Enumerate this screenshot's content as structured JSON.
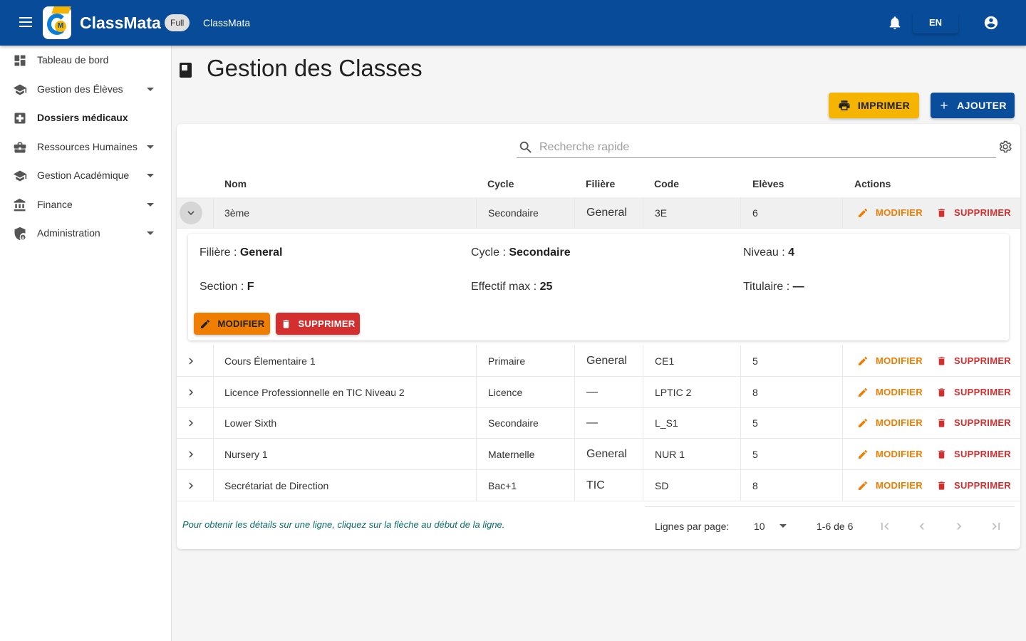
{
  "app": {
    "brand": "ClassMata",
    "plan_badge": "Full",
    "subtitle": "ClassMata",
    "language": "EN",
    "primary_color": "#084c99"
  },
  "sidebar": {
    "items": [
      {
        "label": "Tableau de bord",
        "icon": "dashboard-icon",
        "expandable": false,
        "active": false
      },
      {
        "label": "Gestion des Élèves",
        "icon": "school-icon",
        "expandable": true,
        "active": false
      },
      {
        "label": "Dossiers médicaux",
        "icon": "medical-icon",
        "expandable": false,
        "active": true
      },
      {
        "label": "Ressources Humaines",
        "icon": "briefcase-icon",
        "expandable": true,
        "active": false
      },
      {
        "label": "Gestion Académique",
        "icon": "school-icon",
        "expandable": true,
        "active": false
      },
      {
        "label": "Finance",
        "icon": "bank-icon",
        "expandable": true,
        "active": false
      },
      {
        "label": "Administration",
        "icon": "admin-shield-icon",
        "expandable": true,
        "active": false
      }
    ]
  },
  "page": {
    "title": "Gestion des Classes",
    "print_label": "IMPRIMER",
    "add_label": "AJOUTER"
  },
  "search": {
    "placeholder": "Recherche rapide"
  },
  "table": {
    "headers": {
      "nom": "Nom",
      "cycle": "Cycle",
      "filiere": "Filière",
      "code": "Code",
      "eleves": "Elèves",
      "actions": "Actions"
    },
    "modify_label": "MODIFIER",
    "delete_label": "SUPPRIMER",
    "rows": [
      {
        "nom": "3ème",
        "cycle": "Secondaire",
        "filiere": "General",
        "code": "3E",
        "eleves": "6",
        "expanded": true
      },
      {
        "nom": "Cours Élementaire 1",
        "cycle": "Primaire",
        "filiere": "General",
        "code": "CE1",
        "eleves": "5",
        "expanded": false
      },
      {
        "nom": "Licence Professionnelle en TIC Niveau 2",
        "cycle": "Licence",
        "filiere": "—",
        "code": "LPTIC 2",
        "eleves": "8",
        "expanded": false
      },
      {
        "nom": "Lower Sixth",
        "cycle": "Secondaire",
        "filiere": "—",
        "code": "L_S1",
        "eleves": "5",
        "expanded": false
      },
      {
        "nom": "Nursery 1",
        "cycle": "Maternelle",
        "filiere": "General",
        "code": "NUR 1",
        "eleves": "5",
        "expanded": false
      },
      {
        "nom": "Secrétariat de Direction",
        "cycle": "Bac+1",
        "filiere": "TIC",
        "code": "SD",
        "eleves": "8",
        "expanded": false
      }
    ]
  },
  "detail": {
    "filiere_label": "Filière :",
    "filiere_value": "General",
    "cycle_label": "Cycle :",
    "cycle_value": "Secondaire",
    "niveau_label": "Niveau :",
    "niveau_value": "4",
    "section_label": "Section :",
    "section_value": "F",
    "effectif_label": "Effectif max :",
    "effectif_value": "25",
    "titulaire_label": "Titulaire :",
    "titulaire_value": "—",
    "modify_label": "MODIFIER",
    "delete_label": "SUPPRIMER"
  },
  "footer": {
    "hint": "Pour obtenir les détails sur une ligne, cliquez sur la flèche au début de la ligne.",
    "rows_per_page_label": "Lignes par page:",
    "rows_per_page_value": "10",
    "range": "1-6 de 6"
  }
}
